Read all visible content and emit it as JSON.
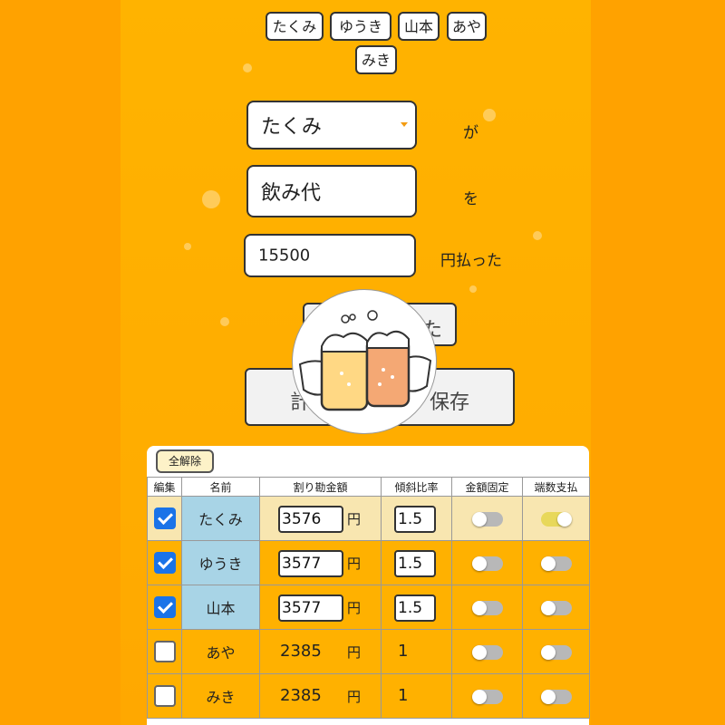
{
  "members": [
    "たくみ",
    "ゆうき",
    "山本",
    "あや",
    "みき"
  ],
  "payer": {
    "value": "たくみ",
    "suffix": "が"
  },
  "item": {
    "value": "飲み代",
    "suffix": "を"
  },
  "amount": {
    "value": "15500",
    "suffix": "円払った"
  },
  "hidden_button_tail": "た",
  "calc_button": {
    "left": "計",
    "right": "保存"
  },
  "table": {
    "clear_all": "全解除",
    "headers": [
      "編集",
      "名前",
      "割り勘金額",
      "傾斜比率",
      "金額固定",
      "端数支払"
    ],
    "yen": "円",
    "rows": [
      {
        "checked": true,
        "name": "たくみ",
        "amount": "3576",
        "ratio": "1.5",
        "fixed": false,
        "fraction": true
      },
      {
        "checked": true,
        "name": "ゆうき",
        "amount": "3577",
        "ratio": "1.5",
        "fixed": false,
        "fraction": false
      },
      {
        "checked": true,
        "name": "山本",
        "amount": "3577",
        "ratio": "1.5",
        "fixed": false,
        "fraction": false
      },
      {
        "checked": false,
        "name": "あや",
        "amount": "2385",
        "ratio": "1",
        "fixed": false,
        "fraction": false
      },
      {
        "checked": false,
        "name": "みき",
        "amount": "2385",
        "ratio": "1",
        "fixed": false,
        "fraction": false
      }
    ]
  },
  "icons": {
    "dropdown": "caret-down-icon",
    "mascot": "beer-cheers-icon"
  },
  "colors": {
    "background": "#ffa200",
    "check": "#1a73e8",
    "name_cell": "#a8d4e6",
    "toggle_on": "#e8d85a"
  }
}
